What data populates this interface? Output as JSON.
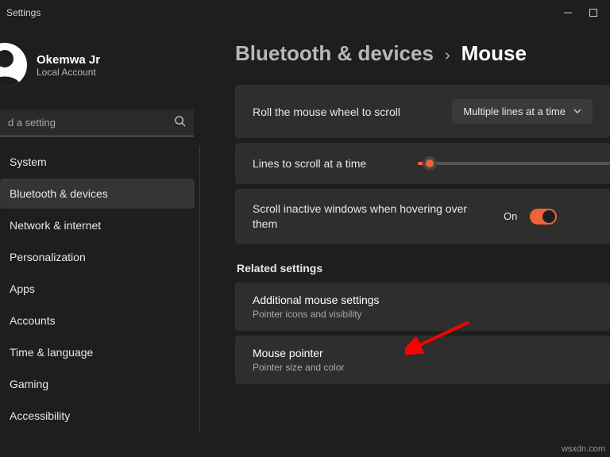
{
  "window": {
    "title": "Settings"
  },
  "profile": {
    "name": "Okemwa Jr",
    "sub": "Local Account"
  },
  "search": {
    "placeholder": "d a setting"
  },
  "nav": {
    "items": [
      "System",
      "Bluetooth & devices",
      "Network & internet",
      "Personalization",
      "Apps",
      "Accounts",
      "Time & language",
      "Gaming",
      "Accessibility"
    ],
    "active_index": 1
  },
  "breadcrumb": {
    "parent": "Bluetooth & devices",
    "sep": "›",
    "current": "Mouse"
  },
  "settings": {
    "scroll_wheel": {
      "label": "Roll the mouse wheel to scroll",
      "value": "Multiple lines at a time"
    },
    "lines": {
      "label": "Lines to scroll at a time"
    },
    "inactive": {
      "label": "Scroll inactive windows when hovering over them",
      "state": "On"
    }
  },
  "related": {
    "heading": "Related settings",
    "items": [
      {
        "title": "Additional mouse settings",
        "sub": "Pointer icons and visibility"
      },
      {
        "title": "Mouse pointer",
        "sub": "Pointer size and color"
      }
    ]
  },
  "watermark": "wsxdn.com"
}
